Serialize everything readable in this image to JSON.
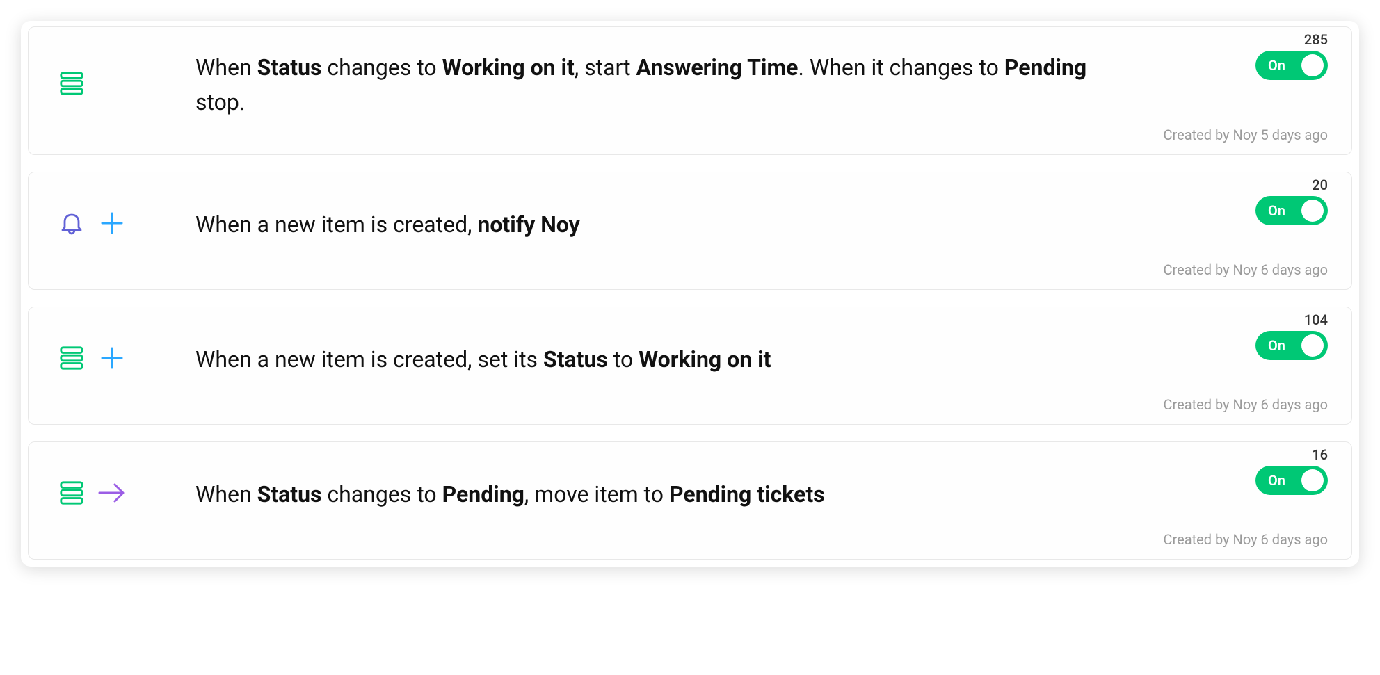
{
  "toggle_label": "On",
  "automations": [
    {
      "count": "285",
      "icons": [
        "status"
      ],
      "segments": [
        {
          "t": "When ",
          "b": false
        },
        {
          "t": "Status",
          "b": true
        },
        {
          "t": " changes to ",
          "b": false
        },
        {
          "t": "Working on it",
          "b": true
        },
        {
          "t": ", start ",
          "b": false
        },
        {
          "t": "Answering Time",
          "b": true
        },
        {
          "t": ". When it changes to ",
          "b": false
        },
        {
          "t": "Pending",
          "b": true
        },
        {
          "t": " stop.",
          "b": false
        }
      ],
      "meta": "Created by Noy 5 days ago"
    },
    {
      "count": "20",
      "icons": [
        "bell",
        "plus"
      ],
      "segments": [
        {
          "t": "When a new item is created, ",
          "b": false
        },
        {
          "t": "notify Noy",
          "b": true
        }
      ],
      "meta": "Created by Noy 6 days ago"
    },
    {
      "count": "104",
      "icons": [
        "status",
        "plus"
      ],
      "segments": [
        {
          "t": "When a new item is created, set its ",
          "b": false
        },
        {
          "t": "Status",
          "b": true
        },
        {
          "t": " to ",
          "b": false
        },
        {
          "t": "Working on it",
          "b": true
        }
      ],
      "meta": "Created by Noy 6 days ago"
    },
    {
      "count": "16",
      "icons": [
        "status",
        "arrow"
      ],
      "segments": [
        {
          "t": "When ",
          "b": false
        },
        {
          "t": "Status",
          "b": true
        },
        {
          "t": " changes to ",
          "b": false
        },
        {
          "t": "Pending",
          "b": true
        },
        {
          "t": ", move item to ",
          "b": false
        },
        {
          "t": "Pending tickets",
          "b": true
        }
      ],
      "meta": "Created by Noy 6 days ago"
    }
  ]
}
